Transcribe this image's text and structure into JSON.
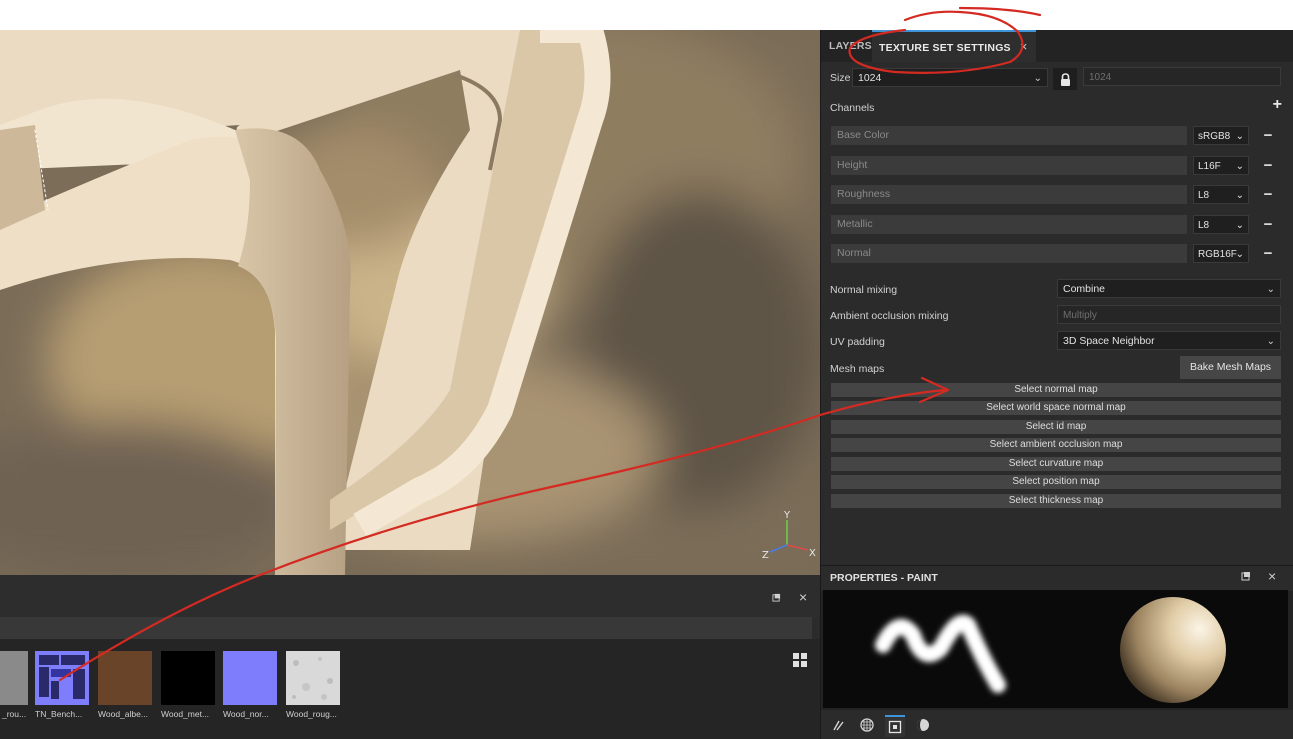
{
  "colors": {
    "annotation_red": "#d42a22",
    "accent_blue": "#3e94d6",
    "panel_bg": "#2b2b2b",
    "swatch_normal": "#7e7dfb",
    "swatch_albedo": "#6a4428",
    "swatch_metallic": "#000000"
  },
  "panel_tabs": {
    "layers": "LAYERS",
    "texture_set_settings": "TEXTURE SET SETTINGS",
    "close_glyph": "×"
  },
  "size": {
    "label": "Size",
    "value": "1024",
    "locked_value": "1024"
  },
  "channels": {
    "label": "Channels",
    "add_glyph": "+",
    "items": [
      {
        "name": "Base Color",
        "format": "sRGB8"
      },
      {
        "name": "Height",
        "format": "L16F"
      },
      {
        "name": "Roughness",
        "format": "L8"
      },
      {
        "name": "Metallic",
        "format": "L8"
      },
      {
        "name": "Normal",
        "format": "RGB16F"
      }
    ],
    "remove_glyph": "−"
  },
  "settings": {
    "normal_mixing_label": "Normal mixing",
    "normal_mixing_value": "Combine",
    "ao_mixing_label": "Ambient occlusion mixing",
    "ao_mixing_value": "Multiply",
    "uv_padding_label": "UV padding",
    "uv_padding_value": "3D Space Neighbor"
  },
  "mesh_maps": {
    "label": "Mesh maps",
    "bake_button": "Bake Mesh Maps",
    "buttons": [
      "Select normal map",
      "Select world space normal map",
      "Select id map",
      "Select ambient occlusion map",
      "Select curvature map",
      "Select position map",
      "Select thickness map"
    ]
  },
  "properties": {
    "title": "PROPERTIES - PAINT",
    "close_glyph": "×"
  },
  "shelf": {
    "close_glyph": "×",
    "items": [
      {
        "label": "_rou...",
        "color": "#8a8a8a",
        "icon": "gray-texture"
      },
      {
        "label": "TN_Bench...",
        "color": "#7e7dfb",
        "icon": "normal-map-texture"
      },
      {
        "label": "Wood_albe...",
        "color": "#6a4428",
        "icon": "albedo-texture"
      },
      {
        "label": "Wood_met...",
        "color": "#000000",
        "icon": "metallic-texture"
      },
      {
        "label": "Wood_nor...",
        "color": "#7e7dfb",
        "icon": "normal-texture"
      },
      {
        "label": "Wood_roug...",
        "color": "#d9d9d9",
        "icon": "roughness-texture"
      }
    ]
  },
  "gizmo": {
    "x": "X",
    "y": "Y",
    "z": "Z"
  }
}
